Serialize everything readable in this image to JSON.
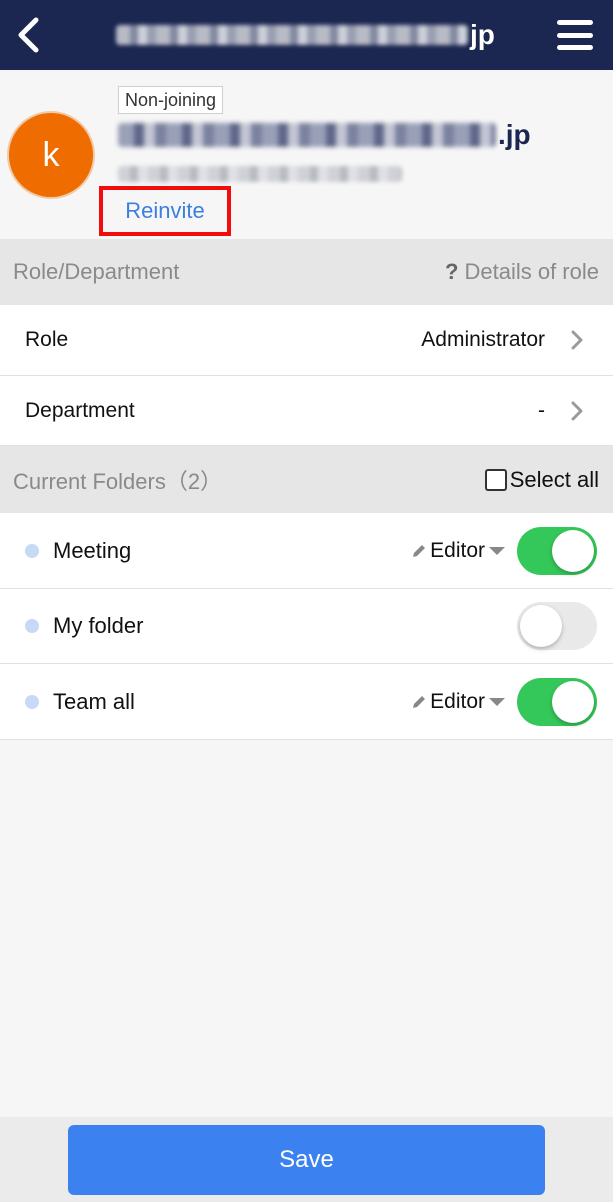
{
  "topbar": {
    "title_suffix": "jp",
    "back_icon": "chevron-left-icon",
    "menu_icon": "hamburger-menu-icon"
  },
  "profile": {
    "avatar_initial": "k",
    "avatar_color": "#ef6c00",
    "status_tag": "Non-joining",
    "name_suffix": ".jp",
    "reinvite_label": "Reinvite"
  },
  "role_section": {
    "header": "Role/Department",
    "details_label": "Details of role",
    "rows": [
      {
        "label": "Role",
        "value": "Administrator"
      },
      {
        "label": "Department",
        "value": "-"
      }
    ]
  },
  "folders_section": {
    "header": "Current Folders（2）",
    "select_all_label": "Select all",
    "folders": [
      {
        "name": "Meeting",
        "permission": "Editor",
        "enabled": true
      },
      {
        "name": "My folder",
        "permission": "",
        "enabled": false
      },
      {
        "name": "Team all",
        "permission": "Editor",
        "enabled": true
      }
    ]
  },
  "footer": {
    "save_label": "Save"
  },
  "colors": {
    "topbar": "#1b2750",
    "accent_blue": "#3b82f0",
    "toggle_on": "#34c759",
    "highlight_box": "#f20d0d"
  }
}
